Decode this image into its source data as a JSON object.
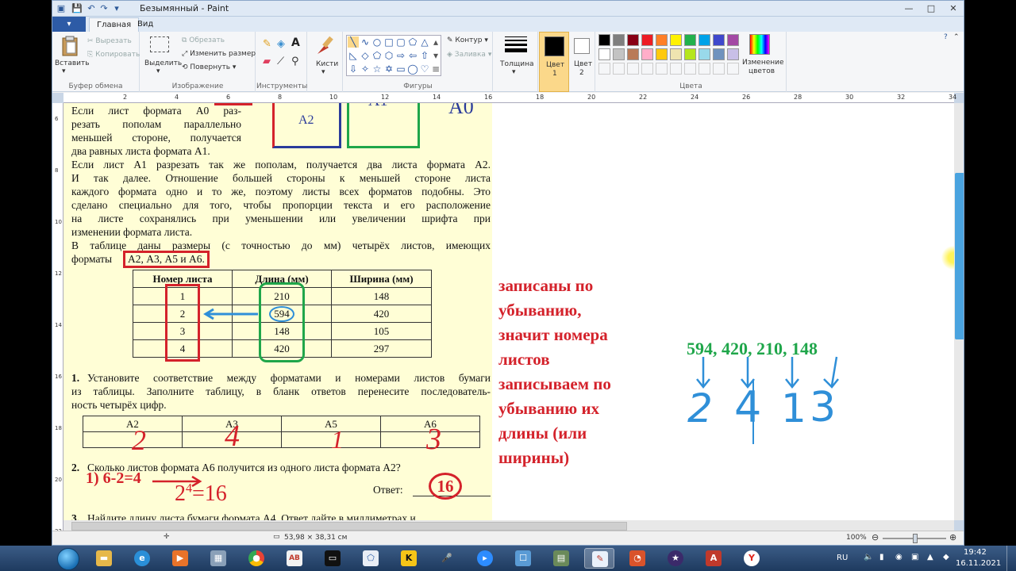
{
  "window": {
    "title": "Безымянный - Paint",
    "controls": [
      "—",
      "□",
      "✕"
    ]
  },
  "tabs": {
    "file": "▾",
    "home": "Главная",
    "view": "Вид"
  },
  "ribbon": {
    "clipboard": {
      "paste": "Вставить",
      "cut": "Вырезать",
      "copy": "Копировать",
      "label": "Буфер обмена"
    },
    "image": {
      "select": "Выделить",
      "crop": "Обрезать",
      "resize": "Изменить размер",
      "rotate": "Повернуть",
      "label": "Изображение"
    },
    "tools": {
      "label": "Инструменты",
      "text_tool": "A"
    },
    "brushes": {
      "label": "Кисти"
    },
    "shapes": {
      "outline": "Контур",
      "fill": "Заливка",
      "label": "Фигуры"
    },
    "size": {
      "label": "Толщина"
    },
    "color1": {
      "label": "Цвет",
      "num": "1"
    },
    "color2": {
      "label": "Цвет",
      "num": "2"
    },
    "colors": {
      "label": "Цвета",
      "edit": "Изменение",
      "edit2": "цветов",
      "palette": [
        "#000000",
        "#7f7f7f",
        "#880015",
        "#ed1c24",
        "#ff7f27",
        "#fff200",
        "#22b14c",
        "#00a2e8",
        "#3f48cc",
        "#a349a4",
        "#ffffff",
        "#c3c3c3",
        "#b97a57",
        "#ffaec9",
        "#ffc90e",
        "#efe4b0",
        "#b5e61d",
        "#99d9ea",
        "#7092be",
        "#c8bfe7"
      ]
    }
  },
  "ruler": {
    "h_ticks": [
      "2",
      "4",
      "6",
      "8",
      "10",
      "12",
      "14",
      "16",
      "18",
      "20",
      "22",
      "24",
      "26",
      "28",
      "30",
      "32",
      "34"
    ],
    "v_ticks": [
      "6",
      "8",
      "10",
      "12",
      "14",
      "16",
      "18",
      "20",
      "22"
    ]
  },
  "doc": {
    "paper_labels": {
      "a2": "А2",
      "a1": "А1",
      "a0": "А0"
    },
    "lines": [
      "Если  лист  формата  А0  раз-",
      "резать  пополам  параллельно",
      "меньшей  стороне,  получается",
      "два равных листа формата А1.",
      "Если лист А1 разрезать так же пополам, получается два листа формата А2.",
      "И так далее. Отношение большей стороны к меньшей стороне листа",
      "каждого формата одно и то же, поэтому листы всех форматов подобны. Это",
      "сделано специально для того, чтобы пропорции текста и его расположение",
      "на листе сохранялись при уменьшении или увеличении шрифта при",
      "изменении формата листа.",
      "В таблице даны размеры (с точностью до мм) четырёх листов, имеющих"
    ],
    "formats_prefix": "форматы",
    "formats_boxed": "А2, А3, А5 и А6.",
    "table": {
      "headers": [
        "Номер листа",
        "Длина (мм)",
        "Ширина (мм)"
      ],
      "rows": [
        [
          "1",
          "210",
          "148"
        ],
        [
          "2",
          "594",
          "420"
        ],
        [
          "3",
          "148",
          "105"
        ],
        [
          "4",
          "420",
          "297"
        ]
      ]
    },
    "q1_num": "1.",
    "q1_lines": [
      "Установите соответствие между форматами и номерами листов бумаги",
      "из таблицы. Заполните таблицу, в бланк ответов перенесите последователь-",
      "ность четырёх цифр."
    ],
    "answer_table": {
      "headers": [
        "А2",
        "А3",
        "А5",
        "А6"
      ],
      "handwritten": [
        "2",
        "4",
        "1",
        "3"
      ]
    },
    "q2_num": "2.",
    "q2_text": "Сколько листов формата А6 получится из одного листа формата А2?",
    "answer_label": "Ответ:",
    "answer_value": "16",
    "work_line1": "1) 6-2=4",
    "work_line2": "2",
    "work_exp": "4",
    "work_eq": "=16",
    "q3_num": "3.",
    "q3_text": "Найдите длину листа бумаги формата А4. Ответ дайте в миллиметрах и"
  },
  "annotation": {
    "red_lines": [
      "записаны по",
      "убыванию,",
      "значит номера",
      "листов",
      "записываем по",
      "убыванию их",
      "длины (или",
      "ширины)"
    ],
    "green_seq": "594, 420, 210, 148",
    "blue_digits": [
      "2",
      "4",
      "1",
      "3"
    ]
  },
  "status": {
    "size": "53,98 × 38,31 см",
    "zoom": "100%"
  },
  "taskbar": {
    "lang": "RU",
    "time": "19:42",
    "date": "16.11.2021"
  }
}
